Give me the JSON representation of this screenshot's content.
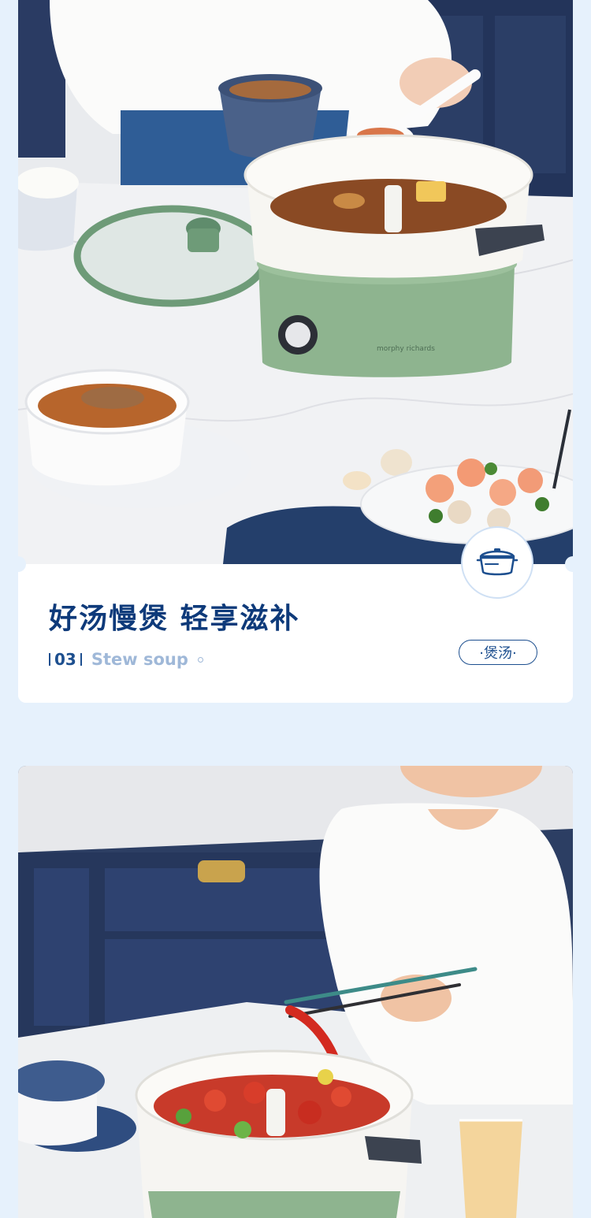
{
  "section": {
    "headline": "好汤慢煲 轻享滋补",
    "index": "03",
    "english_title": "Stew soup",
    "tag_label": "·煲汤·",
    "icon": "pot-icon"
  },
  "photos": {
    "top_brand_print": "morphy richards",
    "top_alt": "green electric hot pot cooking soup on a marble kitchen counter",
    "bottom_alt": "woman picking crayfish from a hot pot with chopsticks"
  },
  "colors": {
    "page_bg": "#e6f1fc",
    "accent_navy": "#0e3a7a",
    "accent_light": "#9fb8d8",
    "pot_green": "#8eb48f"
  }
}
